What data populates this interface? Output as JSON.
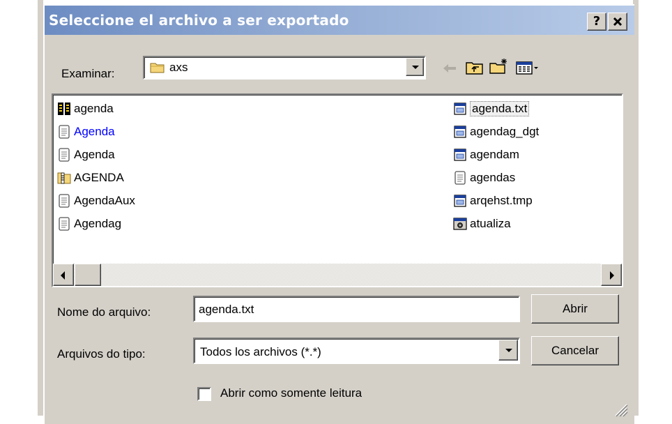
{
  "dialog": {
    "title": "Seleccione el archivo a ser exportado",
    "help_button": "?",
    "close_button": "×"
  },
  "toolbar": {
    "look_in_label": "Examinar:",
    "look_in_value": "axs",
    "icons": [
      "back-arrow-icon",
      "up-folder-icon",
      "new-folder-icon",
      "view-menu-icon"
    ]
  },
  "files": {
    "left": [
      {
        "name": "agenda",
        "icon": "database-icon",
        "color": "#000000"
      },
      {
        "name": "Agenda",
        "icon": "notepad-icon",
        "color": "#0000ff"
      },
      {
        "name": "Agenda",
        "icon": "notepad-icon",
        "color": "#000000"
      },
      {
        "name": "AGENDA",
        "icon": "zip-folder-icon",
        "color": "#000000"
      },
      {
        "name": "AgendaAux",
        "icon": "notepad-icon",
        "color": "#000000"
      },
      {
        "name": "Agendag",
        "icon": "notepad-icon",
        "color": "#000000"
      }
    ],
    "right": [
      {
        "name": "agenda.txt",
        "icon": "window-file-icon",
        "color": "#000000"
      },
      {
        "name": "agendag_dgt",
        "icon": "window-file-icon",
        "color": "#000000"
      },
      {
        "name": "agendam",
        "icon": "window-file-icon",
        "color": "#000000"
      },
      {
        "name": "agendas",
        "icon": "notepad-icon",
        "color": "#000000"
      },
      {
        "name": "arqehst.tmp",
        "icon": "window-file-icon",
        "color": "#000000"
      },
      {
        "name": "atualiza",
        "icon": "setup-program-icon",
        "color": "#000000"
      }
    ]
  },
  "filename": {
    "label": "Nome do arquivo:",
    "value": "agenda.txt"
  },
  "filetype": {
    "label": "Arquivos do tipo:",
    "value": "Todos los archivos (*.*)"
  },
  "readonly": {
    "label": "Abrir como somente leitura",
    "checked": false
  },
  "buttons": {
    "open": "Abrir",
    "cancel": "Cancelar"
  },
  "colors": {
    "dialog_bg": "#d4d0c8",
    "titlebar_start": "#6d8cc2",
    "titlebar_end": "#b8cbe8"
  }
}
